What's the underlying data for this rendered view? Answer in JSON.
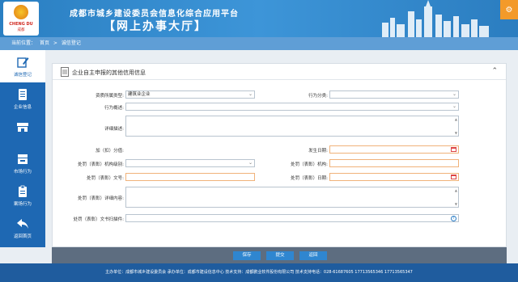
{
  "header": {
    "logo_text": "CHENG DU",
    "logo_sub": "成都",
    "title": "成都市城乡建设委员会信息化综合应用平台",
    "subtitle": "【网上办事大厅】",
    "settings_icon": "gear-icon"
  },
  "breadcrumb": {
    "label": "当前位置：",
    "home": "首页",
    "separator": ">",
    "current": "诚信登记"
  },
  "sidebar": {
    "items": [
      {
        "label": "诚信登记",
        "icon": "edit-icon"
      },
      {
        "label": "企业信息",
        "icon": "document-icon"
      },
      {
        "label": "",
        "icon": "store-icon"
      },
      {
        "label": "市场行为",
        "icon": "market-icon"
      },
      {
        "label": "案场行为",
        "icon": "clipboard-icon"
      },
      {
        "label": "返回首页",
        "icon": "back-arrow-icon"
      }
    ]
  },
  "panel": {
    "title": "企业自主申报的其他信用信息",
    "collapse_icon": "chevron-up-icon"
  },
  "form": {
    "qual_type_label": "资质所属类型:",
    "qual_type_value": "建筑业企业",
    "behavior_cat_label": "行为分类:",
    "behavior_desc_label": "行为概述:",
    "detail_desc_label": "详细描述:",
    "score_label": "加（扣）分值:",
    "occur_date_label": "发生日期:",
    "penalty_level_label": "处罚（表彰）机构级别:",
    "penalty_org_label": "处罚（表彰）机构:",
    "penalty_docno_label": "处罚（表彰）文号:",
    "penalty_date_label": "处罚（表彰）日期:",
    "penalty_detail_label": "处罚（表彰）详细内容:",
    "penalty_attach_label": "处罚（表彰）文书扫描件:"
  },
  "buttons": {
    "save": "保存",
    "submit": "提交",
    "back": "返回"
  },
  "footer": {
    "text": "主办单位：成都市城乡建设委员会  承办单位：成都市建设信息中心  技术支持：成都鹏业软件股份有限公司  技术支持电话：028-61687605 17713565346 17713565347"
  },
  "colors": {
    "header_blue": "#2a7fc2",
    "sidebar_blue": "#1e68b3",
    "button_blue": "#2f86d0",
    "settings_orange": "#f39a2a",
    "footer_blue": "#1f5c9e"
  }
}
